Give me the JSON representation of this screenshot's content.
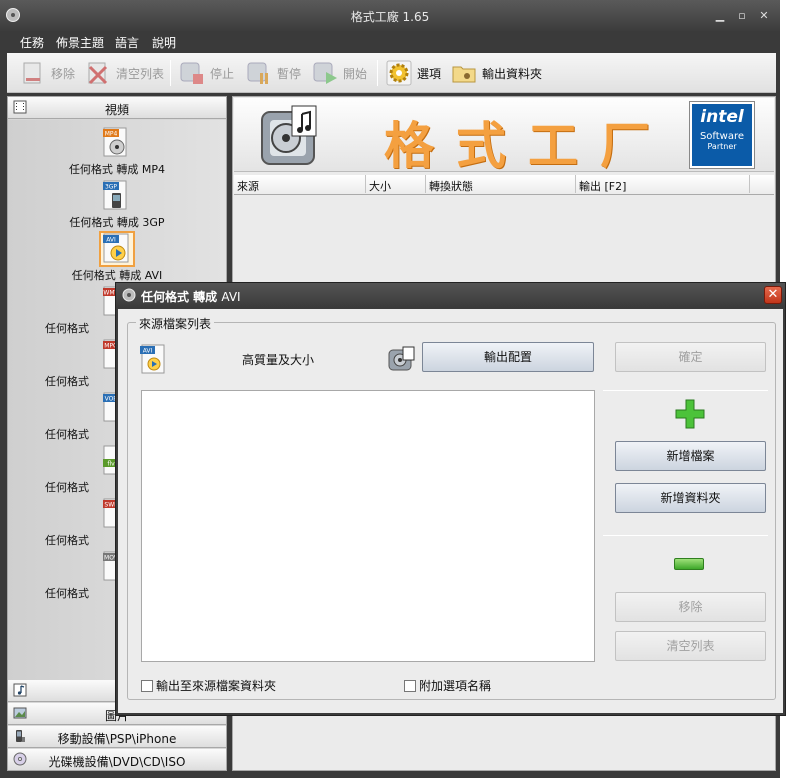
{
  "window": {
    "title": "格式工廠 1.65"
  },
  "menu": [
    "任務",
    "佈景主題",
    "語言",
    "說明"
  ],
  "toolbar": {
    "buttons": [
      {
        "label": "移除",
        "enabled": false,
        "icon": "remove-icon"
      },
      {
        "label": "清空列表",
        "enabled": false,
        "icon": "clear-list-icon"
      },
      {
        "label": "停止",
        "enabled": false,
        "icon": "stop-icon"
      },
      {
        "label": "暫停",
        "enabled": false,
        "icon": "pause-icon"
      },
      {
        "label": "開始",
        "enabled": false,
        "icon": "start-icon"
      },
      {
        "label": "選項",
        "enabled": true,
        "icon": "gear-icon"
      },
      {
        "label": "輸出資料夾",
        "enabled": true,
        "icon": "folder-icon"
      }
    ]
  },
  "sidebar": {
    "video_header": "視頻",
    "items": [
      {
        "label": "任何格式 轉成 MP4",
        "badge": "MP4",
        "badge_color": "#e07a1a"
      },
      {
        "label": "任何格式 轉成 3GP",
        "badge": "3GP",
        "badge_color": "#2a6fb5"
      },
      {
        "label": "任何格式 轉成 AVI",
        "badge": "AVI",
        "badge_color": "#2a6fb5",
        "selected": true
      },
      {
        "label": "任何格式",
        "badge": "WMV",
        "badge_color": "#c0392b"
      },
      {
        "label": "任何格式",
        "badge": "MPG",
        "badge_color": "#c0392b"
      },
      {
        "label": "任何格式",
        "badge": "VOB",
        "badge_color": "#2a6fb5"
      },
      {
        "label": "任何格式",
        "badge": "flv",
        "badge_color": "#5a9a2a"
      },
      {
        "label": "任何格式",
        "badge": "SWF",
        "badge_color": "#c0392b"
      },
      {
        "label": "任何格式",
        "badge": "MOV",
        "badge_color": "#777777"
      }
    ],
    "audio_header": "",
    "picture_header": "圖片",
    "mobile_header": "移動設備\\PSP\\iPhone",
    "disc_header": "光碟機設備\\DVD\\CD\\ISO"
  },
  "content": {
    "banner_title": "格式工厂",
    "intel": {
      "line1": "intel",
      "line2": "Software",
      "line3": "Partner"
    },
    "columns": [
      "來源",
      "大小",
      "轉換狀態",
      "輸出 [F2]"
    ]
  },
  "dialog": {
    "title": "任何格式 轉成",
    "title_suffix": "AVI",
    "group_label": "來源檔案列表",
    "profile_label": "高質量及大小",
    "output_config_button": "輸出配置",
    "ok_button": "確定",
    "add_file_button": "新增檔案",
    "add_folder_button": "新增資料夾",
    "remove_button": "移除",
    "clear_list_button": "清空列表",
    "checkbox_output_to_source": "輸出至來源檔案資料夾",
    "checkbox_append_option_name": "附加選項名稱"
  }
}
